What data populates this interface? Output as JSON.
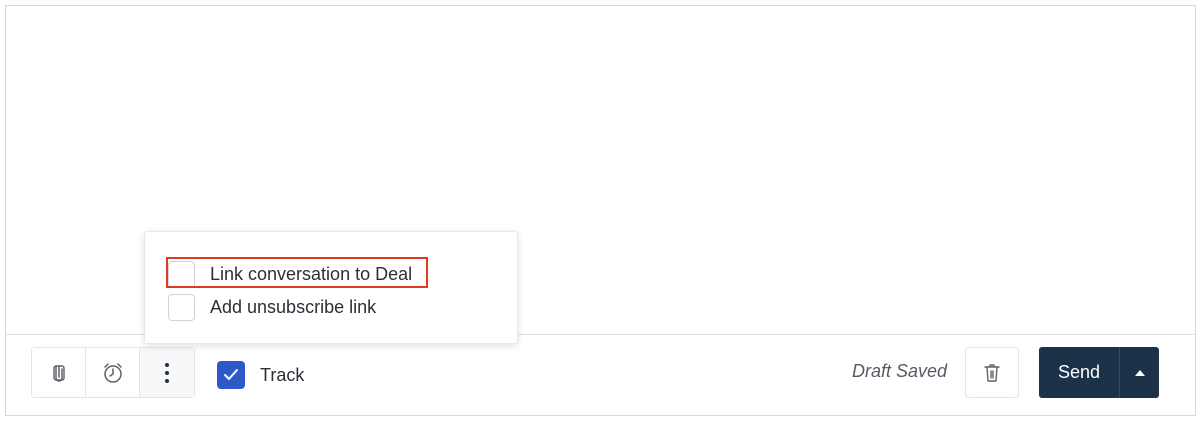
{
  "toolbar": {
    "attach_icon": "paperclip-icon",
    "schedule_icon": "alarm-clock-icon",
    "more_icon": "more-vertical-icon",
    "track": {
      "label": "Track",
      "checked": true
    }
  },
  "status": {
    "draft_text": "Draft Saved"
  },
  "actions": {
    "delete_icon": "trash-icon",
    "send_label": "Send",
    "send_menu_icon": "caret-up-icon"
  },
  "popover": {
    "options": [
      {
        "label": "Link conversation to Deal",
        "checked": false,
        "highlighted": true
      },
      {
        "label": "Add unsubscribe link",
        "checked": false,
        "highlighted": false
      }
    ]
  },
  "colors": {
    "accent": "#2e5ac9",
    "send_bg": "#1b3249",
    "highlight": "#e03a1f"
  }
}
